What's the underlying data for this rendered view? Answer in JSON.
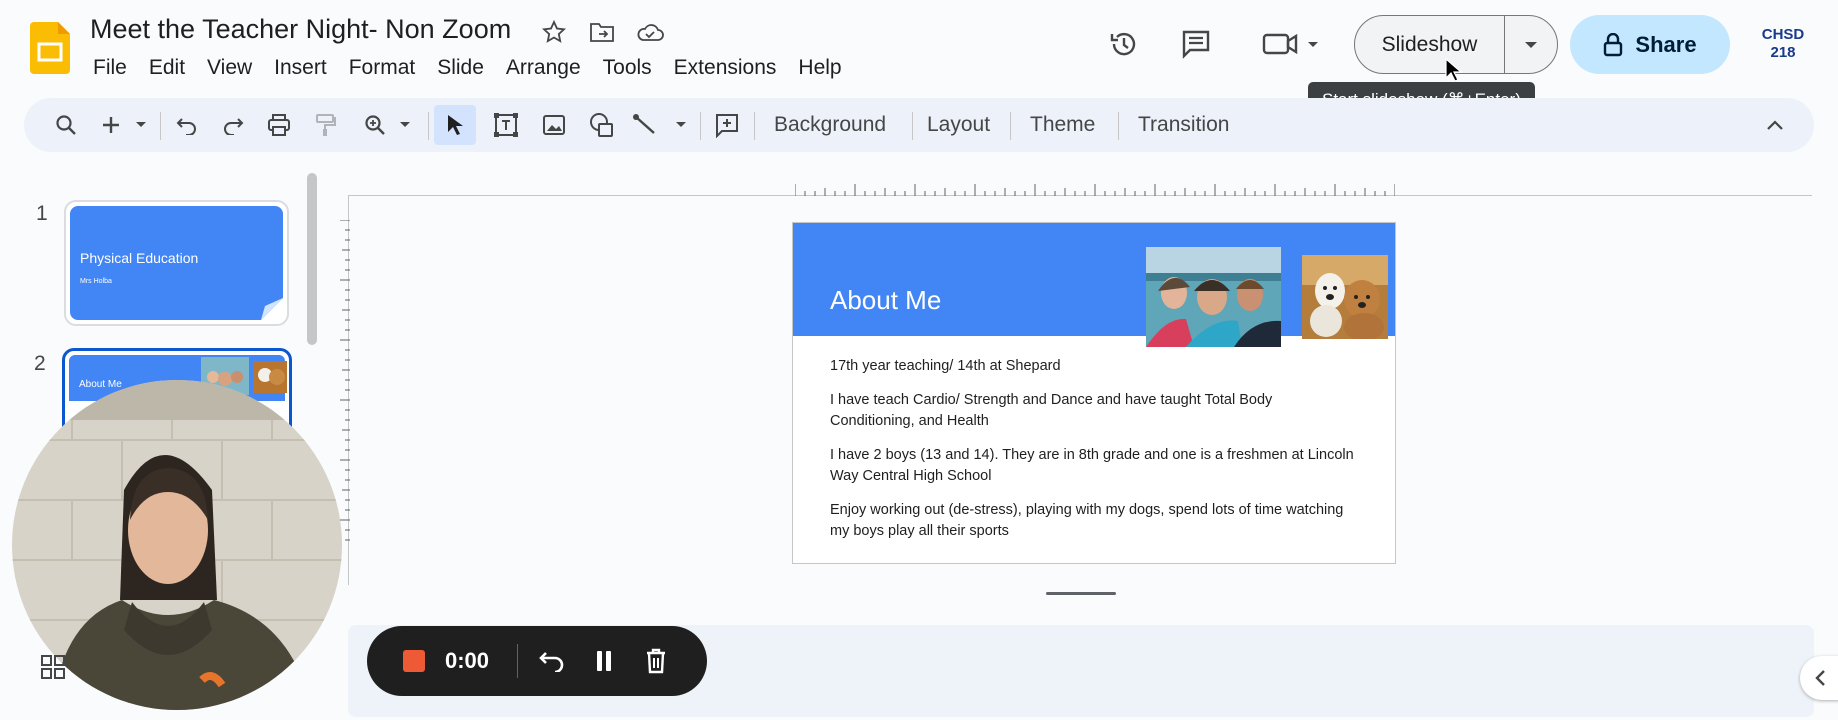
{
  "doc": {
    "title": "Meet the Teacher Night- Non Zoom"
  },
  "menu": [
    "File",
    "Edit",
    "View",
    "Insert",
    "Format",
    "Slide",
    "Arrange",
    "Tools",
    "Extensions",
    "Help"
  ],
  "header": {
    "slideshow_label": "Slideshow",
    "share_label": "Share",
    "account_text": "CHSD 218",
    "tooltip": "Start slideshow (⌘+Enter)"
  },
  "toolbar": {
    "background_label": "Background",
    "layout_label": "Layout",
    "theme_label": "Theme",
    "transition_label": "Transition"
  },
  "filmstrip": {
    "slides": [
      {
        "number": "1",
        "title": "Physical Education",
        "subtitle": "Mrs Holba"
      },
      {
        "number": "2",
        "title": "About Me"
      }
    ]
  },
  "slide": {
    "title": "About Me",
    "bullets": [
      "17th year teaching/ 14th at Shepard",
      "I have teach Cardio/ Strength and Dance and have taught Total Body Conditioning, and Health",
      "I have 2 boys (13 and 14).  They are in 8th grade and one is a freshmen at Lincoln Way Central High School",
      "Enjoy working out (de-stress), playing with my dogs, spend lots of time watching my boys play all their sports"
    ]
  },
  "recorder": {
    "time": "0:00"
  },
  "colors": {
    "accent_blue": "#4285f4",
    "share_bg": "#c2e7ff",
    "record_red": "#ee5a36"
  }
}
